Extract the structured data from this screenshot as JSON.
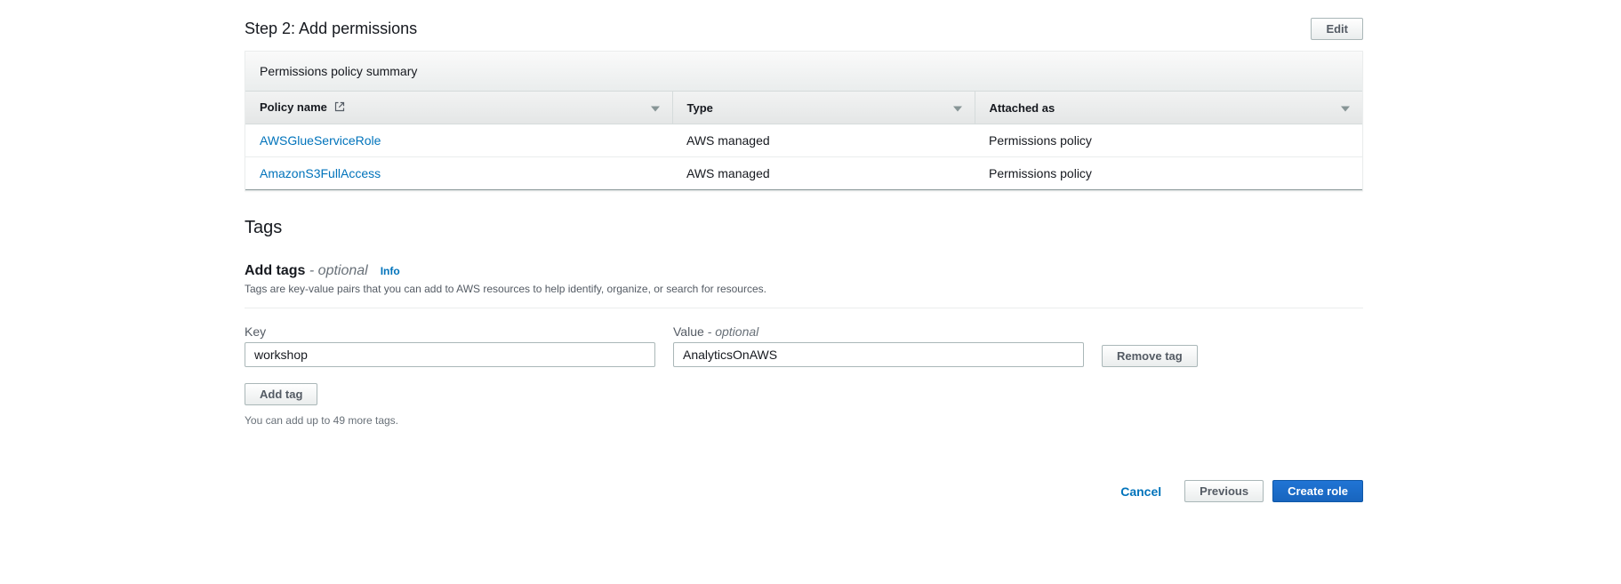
{
  "step2": {
    "title": "Step 2: Add permissions",
    "edit_button": "Edit"
  },
  "policy_summary": {
    "header": "Permissions policy summary",
    "columns": {
      "name": "Policy name",
      "type": "Type",
      "attached": "Attached as"
    },
    "rows": [
      {
        "name": "AWSGlueServiceRole",
        "type": "AWS managed",
        "attached": "Permissions policy"
      },
      {
        "name": "AmazonS3FullAccess",
        "type": "AWS managed",
        "attached": "Permissions policy"
      }
    ]
  },
  "tags": {
    "heading": "Tags",
    "add_label": "Add tags",
    "optional_suffix": " - optional",
    "info_label": "Info",
    "description": "Tags are key-value pairs that you can add to AWS resources to help identify, organize, or search for resources.",
    "key_label": "Key",
    "value_label": "Value",
    "value_optional": " - optional",
    "key_input": "workshop",
    "value_input": "AnalyticsOnAWS",
    "remove_button": "Remove tag",
    "add_button": "Add tag",
    "limit_text": "You can add up to 49 more tags."
  },
  "footer": {
    "cancel": "Cancel",
    "previous": "Previous",
    "create": "Create role"
  }
}
